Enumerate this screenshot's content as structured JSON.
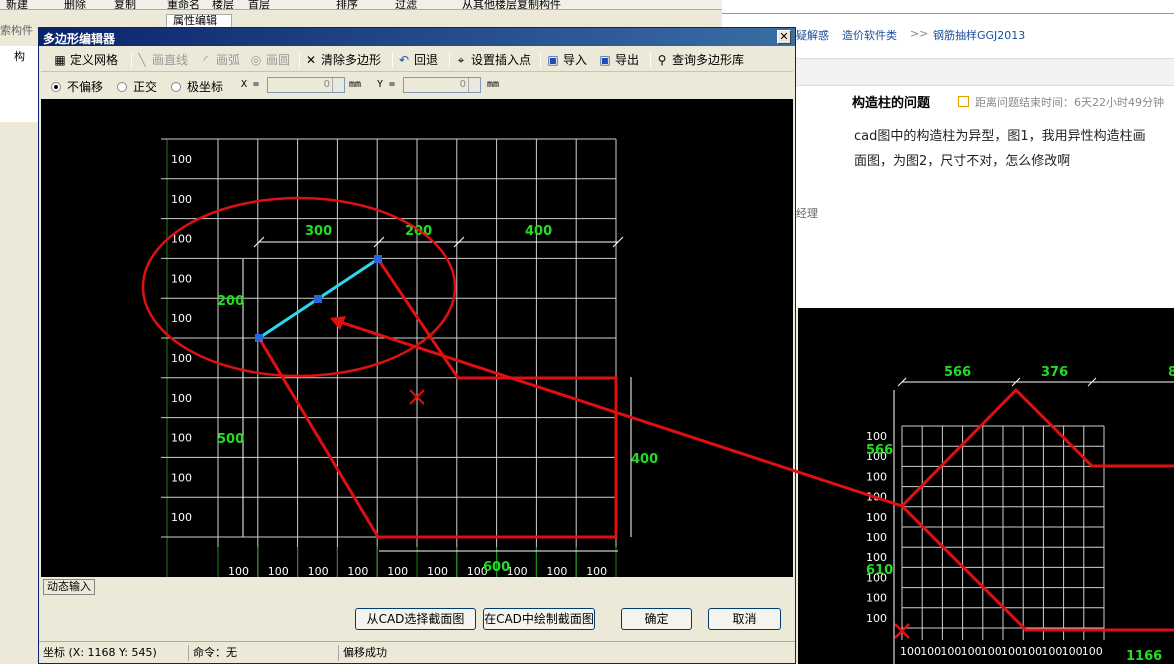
{
  "bg_app": {
    "toolbar": [
      "新建",
      "删除",
      "复制",
      "重命名",
      "楼层",
      "首层",
      "排序",
      "过滤",
      "从其他楼层复制构件"
    ],
    "prop_tab": "属性编辑",
    "tree_label": "索构件",
    "tree_root": "构"
  },
  "web": {
    "breadcrumb": [
      "疑解惑",
      "造价软件类",
      ">>",
      "钢筋抽样GGJ2013"
    ],
    "question_title": "构造柱的问题",
    "timer_text": "距离问题结束时间：6天22小时49分钟",
    "body_line1": "cad图中的构造柱为异型，图1，我用异性构造柱画",
    "body_line2": "面图，为图2，尺寸不对，怎么修改啊",
    "manager_text": "经理"
  },
  "dialog": {
    "title": "多边形编辑器",
    "toolbar": {
      "define_grid": "定义网格",
      "draw_line": "画直线",
      "draw_arc": "画弧",
      "draw_circle": "画圆",
      "clear_polygon": "清除多边形",
      "undo": "回退",
      "set_insert_point": "设置插入点",
      "import": "导入",
      "export": "导出",
      "query_library": "查询多边形库"
    },
    "offset_modes": [
      "不偏移",
      "正交",
      "极坐标"
    ],
    "x_label": "X =",
    "y_label": "Y =",
    "x_value": "0",
    "y_value": "0",
    "unit": "mm",
    "dynamic_input": "动态输入",
    "buttons": {
      "select_from_cad": "从CAD选择截面图",
      "draw_in_cad": "在CAD中绘制截面图",
      "ok": "确定",
      "cancel": "取消"
    },
    "status": {
      "coords": "坐标 (X: 1168 Y: 545)",
      "command": "命令：无",
      "message": "偏移成功"
    },
    "grid": {
      "row_labels": [
        "100",
        "100",
        "100",
        "100",
        "100",
        "100",
        "100",
        "100",
        "100",
        "100"
      ],
      "col_labels": [
        "100",
        "100",
        "100",
        "100",
        "100",
        "100",
        "100",
        "100",
        "100",
        "100"
      ],
      "dim_top": [
        "300",
        "200",
        "400"
      ],
      "dim_left": [
        "200",
        "500"
      ],
      "dim_right": "400",
      "dim_bottom": "600"
    }
  },
  "figure2": {
    "dim_top": [
      "566",
      "376",
      "8"
    ],
    "dim_left": [
      "566",
      "610"
    ],
    "dim_bottom": "1166",
    "row_labels": [
      "100",
      "100",
      "100",
      "100",
      "100",
      "100",
      "100",
      "100",
      "100",
      "100"
    ],
    "col_labels": [
      "100",
      "100",
      "100",
      "100",
      "100",
      "100",
      "100",
      "100",
      "100",
      "100"
    ]
  },
  "colors": {
    "dim_text": "#22dd22",
    "grid": "#cfcfcf",
    "polygon": "#e01010",
    "selection": "#2ed6ef",
    "title_bar": "#0a246a"
  }
}
